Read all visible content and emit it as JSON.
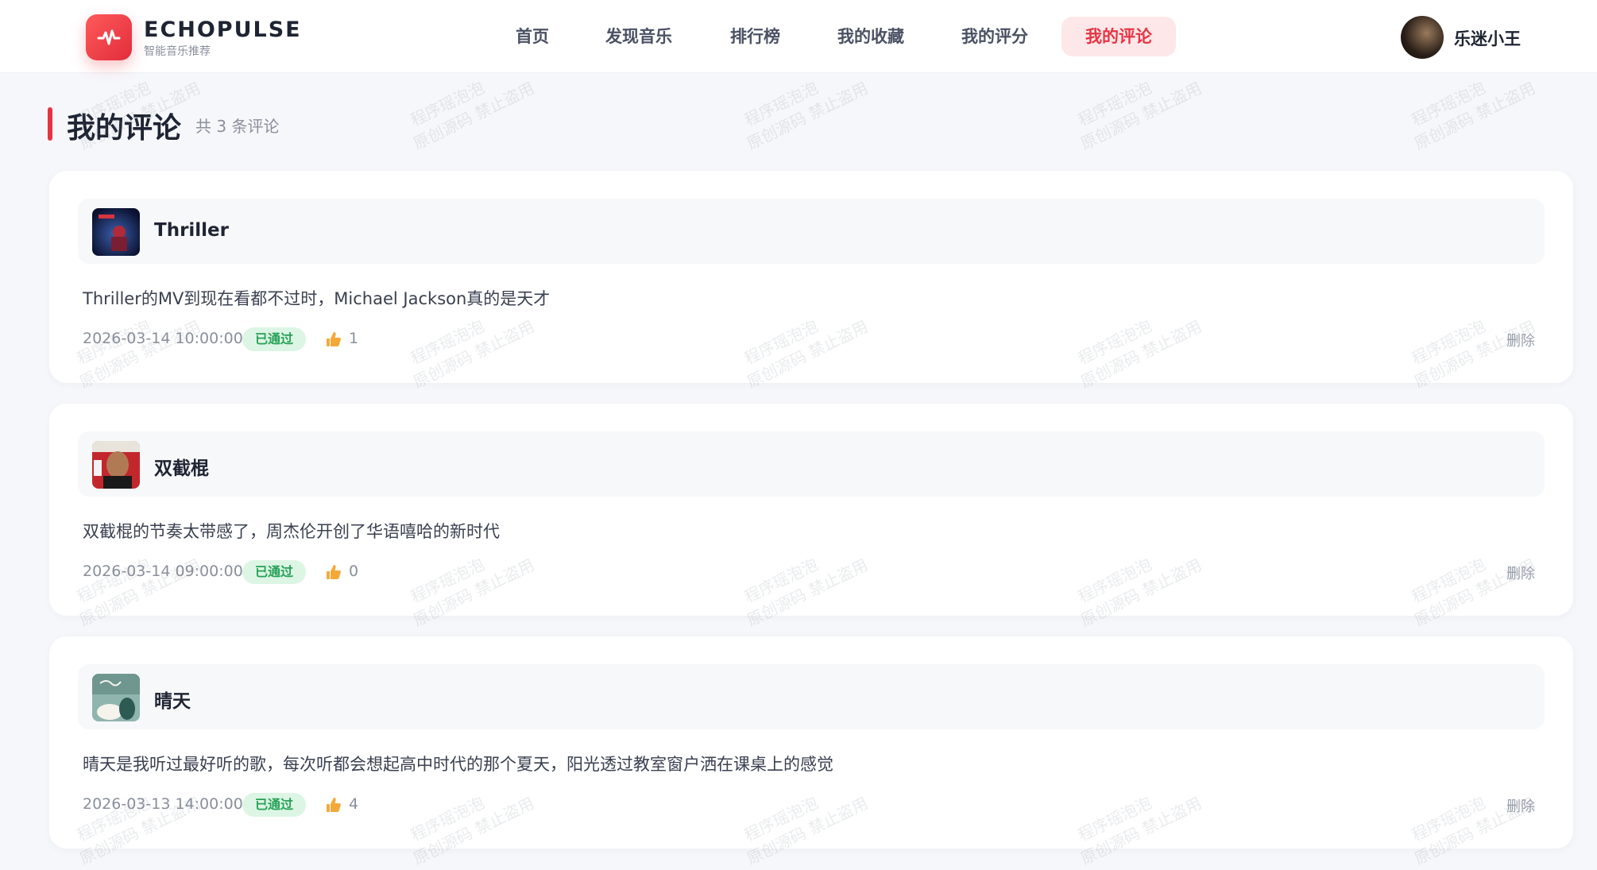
{
  "brand": {
    "name": "ECHOPULSE",
    "subtitle": "智能音乐推荐"
  },
  "nav": [
    {
      "label": "首页",
      "active": false
    },
    {
      "label": "发现音乐",
      "active": false
    },
    {
      "label": "排行榜",
      "active": false
    },
    {
      "label": "我的收藏",
      "active": false
    },
    {
      "label": "我的评分",
      "active": false
    },
    {
      "label": "我的评论",
      "active": true
    }
  ],
  "user": {
    "name": "乐迷小王"
  },
  "page": {
    "title": "我的评论",
    "count_text": "共 3 条评论"
  },
  "comments": [
    {
      "song": "Thriller",
      "text": "Thriller的MV到现在看都不过时，Michael Jackson真的是天才",
      "time": "2026-03-14 10:00:00",
      "status": "已通过",
      "likes": "1",
      "delete_label": "删除"
    },
    {
      "song": "双截棍",
      "text": "双截棍的节奏太带感了，周杰伦开创了华语嘻哈的新时代",
      "time": "2026-03-14 09:00:00",
      "status": "已通过",
      "likes": "0",
      "delete_label": "删除"
    },
    {
      "song": "晴天",
      "text": "晴天是我听过最好听的歌，每次听都会想起高中时代的那个夏天，阳光透过教室窗户洒在课桌上的感觉",
      "time": "2026-03-13 14:00:00",
      "status": "已通过",
      "likes": "4",
      "delete_label": "删除"
    }
  ],
  "watermark": {
    "line1": "程序瑶泡泡",
    "line2": "原创源码 禁止盗用"
  },
  "colors": {
    "accent": "#e53543",
    "accent_bg": "#fde7e9",
    "approved_bg": "#dcf5e4",
    "approved_text": "#26a157"
  }
}
